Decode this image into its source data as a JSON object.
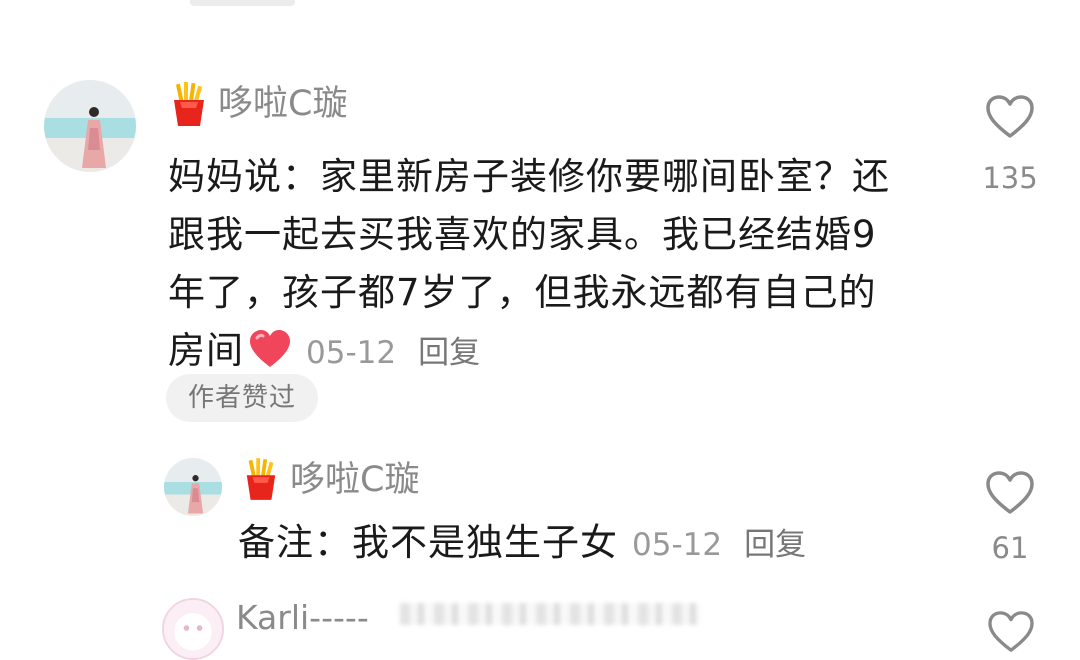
{
  "main_comment": {
    "username": "哆啦C璇",
    "badge_icon": "french-fries-icon",
    "text": "妈妈说：家里新房子装修你要哪间卧室？还跟我一起去买我喜欢的家具。我已经结婚9年了，孩子都7岁了，但我永远都有自己的房间",
    "date": "05-12",
    "reply_label": "回复",
    "likes": "135",
    "author_liked_label": "作者赞过"
  },
  "reply": {
    "username": "哆啦C璇",
    "badge_icon": "french-fries-icon",
    "text": "备注：我不是独生子女",
    "date": "05-12",
    "reply_label": "回复",
    "likes": "61"
  },
  "next_comment": {
    "username": "Karli-----"
  },
  "colors": {
    "username": "#8a8a8a",
    "meta": "#999999",
    "pill_bg": "#f1f1f1",
    "heart_emoji": "#f0455a"
  }
}
